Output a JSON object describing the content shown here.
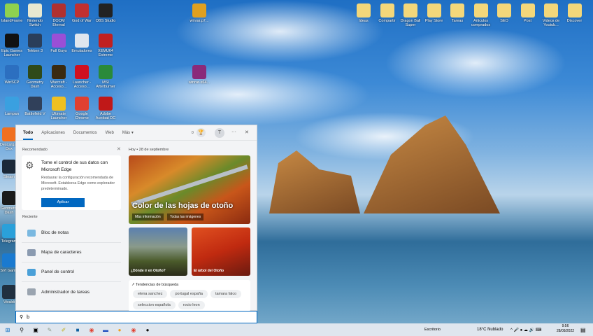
{
  "desktop": {
    "left_icons": [
      {
        "label": "IslandFrame",
        "color": "#8fd14f"
      },
      {
        "label": "Nintendo Switch",
        "color": "#e8e8d0"
      },
      {
        "label": "DOOM Eternal",
        "color": "#b03030"
      },
      {
        "label": "God of War",
        "color": "#c03030"
      },
      {
        "label": "OBS Studio",
        "color": "#222222"
      },
      {
        "label": "Epic Games Launcher",
        "color": "#111111"
      },
      {
        "label": "Tekken 3",
        "color": "#2a3e5a"
      },
      {
        "label": "Fall Guys",
        "color": "#9a4fd6"
      },
      {
        "label": "Emuladores",
        "color": "#dfe6ee"
      },
      {
        "label": "XEMU64 Extreme",
        "color": "#c02020"
      },
      {
        "label": "WinSCP",
        "color": "#2c6fc0"
      },
      {
        "label": "Geometry Dash",
        "color": "#2f4a1a"
      },
      {
        "label": "Warcraft - Acceso...",
        "color": "#3a2a10"
      },
      {
        "label": "Launcher - Acceso...",
        "color": "#d01020"
      },
      {
        "label": "MSI Afterburner",
        "color": "#2a8a3a"
      },
      {
        "label": "Lampan",
        "color": "#3aa0e0"
      },
      {
        "label": "Battlefield V",
        "color": "#30405a"
      },
      {
        "label": "Ultimate Launcher",
        "color": "#f0c020"
      },
      {
        "label": "Google Chrome",
        "color": "#e04030"
      },
      {
        "label": "Adobe Acrobat DC",
        "color": "#c01818"
      }
    ],
    "edge_icons": [
      {
        "label": "Descargas Dex",
        "color": "#f07020"
      },
      {
        "label": "Steam",
        "color": "#1b2838"
      },
      {
        "label": "Geometry Dash",
        "color": "#1a1a1a"
      },
      {
        "label": "Telegram",
        "color": "#2aa0da"
      },
      {
        "label": "SVI Game",
        "color": "#1a7ad0"
      },
      {
        "label": "Vivaldi",
        "color": "#203040"
      }
    ],
    "mid_icons": [
      {
        "label": "winrar.p7...",
        "color": "#e0a020"
      },
      {
        "label": "winrar-x64...",
        "color": "#8a2a7a"
      }
    ],
    "folders": [
      {
        "label": "Ideas"
      },
      {
        "label": "Compartir"
      },
      {
        "label": "Dragon Ball Super"
      },
      {
        "label": "Play Store"
      },
      {
        "label": "Tareas"
      },
      {
        "label": "Articulos comprados"
      },
      {
        "label": "SEO"
      },
      {
        "label": "Post"
      },
      {
        "label": "Videos de Youtub..."
      },
      {
        "label": "Discover"
      }
    ]
  },
  "search_panel": {
    "tabs": [
      "Todo",
      "Aplicaciones",
      "Documentos",
      "Web",
      "Más ▾"
    ],
    "points": "0",
    "avatar": "T",
    "more": "···",
    "close": "✕",
    "recommended_label": "Recomendado",
    "rec_card": {
      "title": "Tome el control de sus datos con Microsoft Edge",
      "body": "Restaurar la configuración recomendada de Microsoft. Establezca Edge como explorador predeterminado.",
      "button": "Aplicar"
    },
    "recent_label": "Reciente",
    "recent": [
      "Bloc de notas",
      "Mapa de caracteres",
      "Panel de control",
      "Administrador de tareas"
    ],
    "date": "Hoy  •  28 de septiembre",
    "hero": {
      "title": "Color de las hojas de otoño",
      "link1": "Más información",
      "link2": "Todas las imágenes"
    },
    "tiles": [
      "¿Dónde ir en Otoño?",
      "El árbol del Otoño"
    ],
    "trends_title": "↗ Tendencias de búsqueda",
    "trends": [
      "elena sanchez",
      "portugal españa",
      "tamara falco",
      "seleccion española",
      "rocio leon"
    ],
    "query": "b"
  },
  "taskbar": {
    "desktop_label": "Escritorio",
    "weather": "18°C  Nublado",
    "time": "9:56",
    "date": "28/09/2022"
  }
}
